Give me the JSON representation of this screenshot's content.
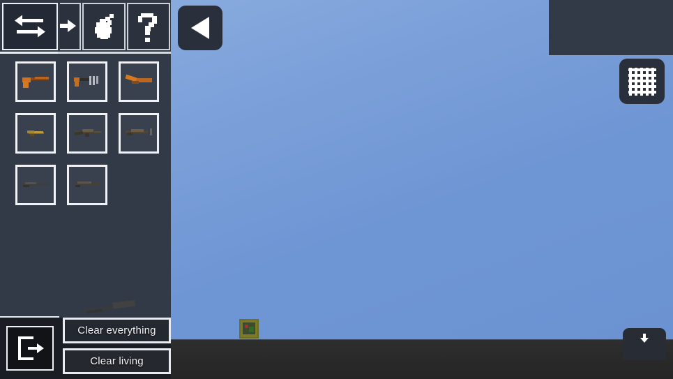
{
  "scene": {
    "sky_color": "#6f96d4",
    "ground_color": "#2b2b2b",
    "player": {
      "name": "player-sprite",
      "body_color": "#7b7a27",
      "accent_color": "#2f6b22"
    }
  },
  "sidebar": {
    "background": "#323a47",
    "tabs": [
      {
        "id": "swap",
        "icon": "swap-arrows-icon",
        "selected": true
      },
      {
        "id": "arrow",
        "icon": "right-arrow-icon",
        "selected": false
      },
      {
        "id": "grenade",
        "icon": "grenade-icon",
        "selected": false
      },
      {
        "id": "help",
        "icon": "question-mark-icon",
        "selected": false
      }
    ],
    "weapons": [
      [
        {
          "id": "pistol",
          "icon": "pistol-icon",
          "tint": "#c4621d"
        },
        {
          "id": "smg",
          "icon": "submachine-gun-icon",
          "tint": "#b8601f"
        },
        {
          "id": "sawed-off-shotgun",
          "icon": "sawed-off-shotgun-icon",
          "tint": "#c96c22"
        }
      ],
      [
        {
          "id": "carbine",
          "icon": "carbine-icon",
          "tint": "#9a7a3c"
        },
        {
          "id": "assault-rifle",
          "icon": "assault-rifle-icon",
          "tint": "#6a5a44"
        },
        {
          "id": "battle-rifle",
          "icon": "battle-rifle-icon",
          "tint": "#6e5c43"
        }
      ],
      [
        {
          "id": "sniper-rifle",
          "icon": "sniper-rifle-icon",
          "tint": "#4a4640"
        },
        {
          "id": "long-rifle",
          "icon": "long-rifle-icon",
          "tint": "#4e4a43"
        }
      ]
    ],
    "bottom": {
      "exit_icon": "exit-door-icon",
      "clear_everything_label": "Clear everything",
      "clear_living_label": "Clear living"
    }
  },
  "controls": {
    "back_icon": "play-left-triangle-icon",
    "rewind_icon": "rewind-icon",
    "pause_icon": "pause-icon",
    "grid_icon": "grid-icon",
    "collapse_icon": "collapse-down-icon",
    "timeline_fill_color": "#f2f4f8"
  }
}
